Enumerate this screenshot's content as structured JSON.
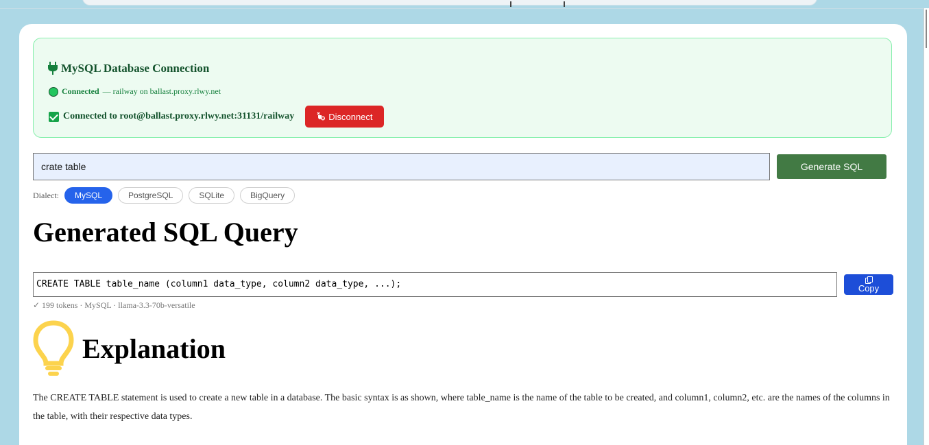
{
  "connection": {
    "title": "MySQL Database Connection",
    "status_label": "Connected",
    "status_detail": " — railway on ballast.proxy.rlwy.net",
    "connected_text": "Connected to root@ballast.proxy.rlwy.net:31131/railway",
    "disconnect_label": "Disconnect"
  },
  "query": {
    "input_value": "crate table",
    "generate_label": "Generate SQL"
  },
  "dialect": {
    "label": "Dialect:",
    "options": [
      "MySQL",
      "PostgreSQL",
      "SQLite",
      "BigQuery"
    ],
    "selected": "MySQL"
  },
  "result": {
    "heading": "Generated SQL Query",
    "sql": "CREATE TABLE table_name (column1 data_type, column2 data_type, ...);",
    "copy_label": "Copy",
    "meta": "✓ 199 tokens · MySQL · llama-3.3-70b-versatile"
  },
  "explanation": {
    "heading": "Explanation",
    "text": "The CREATE TABLE statement is used to create a new table in a database. The basic syntax is as shown, where table_name is the name of the table to be created, and column1, column2, etc. are the names of the columns in the table, with their respective data types."
  },
  "icons": {
    "plug": "electric-plug-icon",
    "status": "green-circle-icon",
    "check": "check-mark-icon",
    "disconnect": "unplug-icon",
    "copy": "copy-icon",
    "bulb": "light-bulb-icon"
  },
  "colors": {
    "page_background": "#add8e6",
    "connection_panel": "#edfbf1",
    "disconnect_button": "#dc2626",
    "generate_button": "#427a44",
    "active_dialect": "#2563eb",
    "copy_button": "#1d4ed8",
    "bulb": "#fcd34d"
  }
}
